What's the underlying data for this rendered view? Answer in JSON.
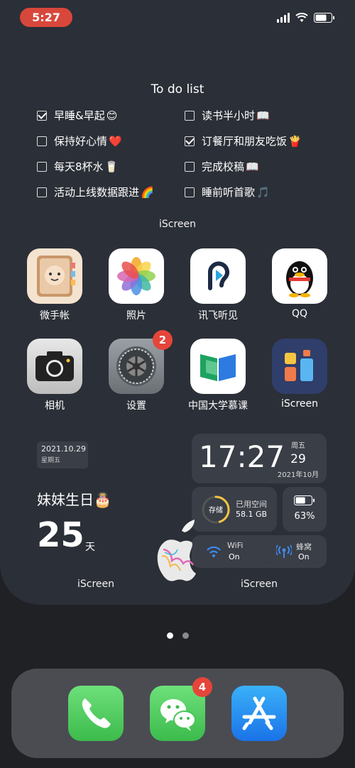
{
  "status": {
    "time": "5:27"
  },
  "todo": {
    "title": "To do list",
    "items": [
      {
        "text": "早睡&早起",
        "emoji": "😊",
        "checked": true
      },
      {
        "text": "读书半小时",
        "emoji": "📖",
        "checked": false
      },
      {
        "text": "保持好心情",
        "emoji": "❤️",
        "checked": false
      },
      {
        "text": "订餐厅和朋友吃饭",
        "emoji": "🍟",
        "checked": true
      },
      {
        "text": "每天8杯水",
        "emoji": "🥛",
        "checked": false
      },
      {
        "text": "完成校稿",
        "emoji": "📖",
        "checked": false
      },
      {
        "text": "活动上线数据跟进",
        "emoji": "🌈",
        "checked": false
      },
      {
        "text": "睡前听首歌",
        "emoji": "🎵",
        "checked": false
      }
    ],
    "widget_label": "iScreen"
  },
  "apps": [
    {
      "label": "微手帐",
      "icon": "notebook-icon"
    },
    {
      "label": "照片",
      "icon": "photos-icon"
    },
    {
      "label": "讯飞听见",
      "icon": "ear-icon"
    },
    {
      "label": "QQ",
      "icon": "penguin-icon"
    },
    {
      "label": "相机",
      "icon": "camera-icon"
    },
    {
      "label": "设置",
      "icon": "gear-icon",
      "badge": "2"
    },
    {
      "label": "中国大学慕课",
      "icon": "book-icon"
    },
    {
      "label": "iScreen",
      "icon": "iscreen-icon"
    }
  ],
  "date_widget": {
    "date": "2021.10.29",
    "weekday": "星期五",
    "title": "妹妹生日",
    "emoji": "🎂",
    "days": "25",
    "unit": "天",
    "label": "iScreen"
  },
  "clock_widget": {
    "time": "17:27",
    "weekday": "周五",
    "day": "29",
    "month": "2021年10月"
  },
  "storage_widget": {
    "ring_label": "存储",
    "title": "已用空间",
    "value": "58.1 GB",
    "used_fraction": 0.45
  },
  "battery_widget": {
    "percent": "63%",
    "level": 0.63
  },
  "wifi_widget": {
    "name": "WiFi",
    "state": "On"
  },
  "cellular_widget": {
    "name": "蜂窝",
    "state": "On"
  },
  "right_label": "iScreen",
  "dock": [
    {
      "icon": "phone-icon"
    },
    {
      "icon": "wechat-icon",
      "badge": "4"
    },
    {
      "icon": "app-store-icon"
    }
  ],
  "colors": {
    "accent": "#f5c542",
    "badge": "#e5453a",
    "time_pill": "#d8473b"
  }
}
